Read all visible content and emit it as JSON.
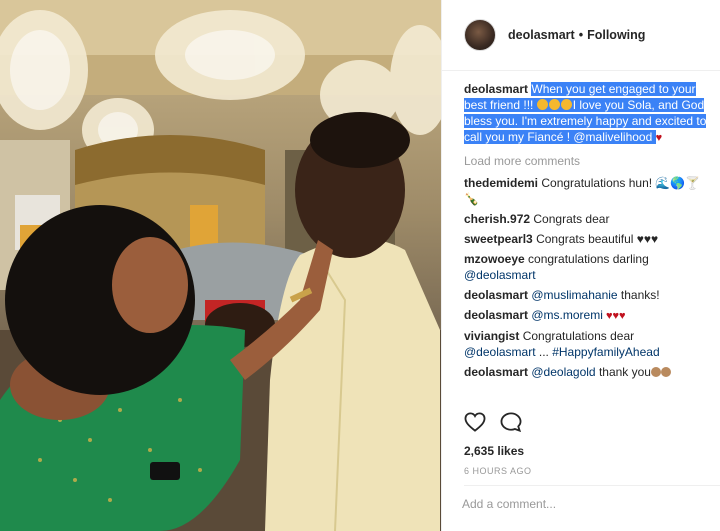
{
  "post": {
    "image_alt": "Engagement photo",
    "author": "deolasmart",
    "follow_state": "Following",
    "separator": "•"
  },
  "caption": {
    "username": "deolasmart",
    "text_part1": "When you get engaged to your best friend !!! ",
    "text_part2": "I love you Sola, and God bless you. I'm extremely happy and excited to call you my Fiancé ! ",
    "mention": "@malivelihood",
    "heart": "♥"
  },
  "load_more_label": "Load more comments",
  "comments": [
    {
      "user": "thedemidemi",
      "text": "Congratulations hun! 🌊🌎🍸🍾"
    },
    {
      "user": "cherish.972",
      "text": "Congrats dear"
    },
    {
      "user": "sweetpearl3",
      "text": "Congrats beautiful ♥♥♥"
    },
    {
      "user": "mzowoeye",
      "text": "congratulations darling",
      "mention": "@deolasmart"
    },
    {
      "user": "deolasmart",
      "mention": "@muslimahanie",
      "text": " thanks!"
    },
    {
      "user": "deolasmart",
      "mention": "@ms.moremi",
      "text": " ♥♥♥"
    },
    {
      "user": "viviangist",
      "text": "Congratulations dear",
      "mention": "@deolasmart",
      "text2": " ... ",
      "hashtag": "#HappyfamilyAhead"
    },
    {
      "user": "deolasmart",
      "mention": "@deolagold",
      "text": " thank you"
    }
  ],
  "likes": "2,635 likes",
  "timestamp": "6 HOURS AGO",
  "add_comment_placeholder": "Add a comment...",
  "icons": {
    "like": "heart-outline-icon",
    "comment": "comment-bubble-icon"
  },
  "colors": {
    "selection": "#3b82f6",
    "link": "#003569",
    "muted": "#999999",
    "heart": "#c1121f"
  }
}
